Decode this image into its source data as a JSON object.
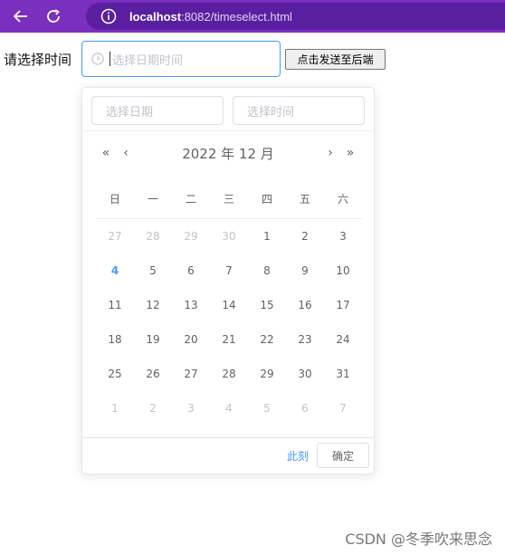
{
  "browser": {
    "url_host": "localhost",
    "url_rest": ":8082/timeselect.html",
    "toolbar_color": "#7b2fbf"
  },
  "form": {
    "label": "请选择时间",
    "input_placeholder": "选择日期时间",
    "send_button": "点击发送至后端"
  },
  "picker": {
    "date_placeholder": "选择日期",
    "time_placeholder": "选择时间",
    "year_month": "2022 年  12 月",
    "weekdays": [
      "日",
      "一",
      "二",
      "三",
      "四",
      "五",
      "六"
    ],
    "weeks": [
      [
        "27",
        "28",
        "29",
        "30",
        "1",
        "2",
        "3"
      ],
      [
        "4",
        "5",
        "6",
        "7",
        "8",
        "9",
        "10"
      ],
      [
        "11",
        "12",
        "13",
        "14",
        "15",
        "16",
        "17"
      ],
      [
        "18",
        "19",
        "20",
        "21",
        "22",
        "23",
        "24"
      ],
      [
        "25",
        "26",
        "27",
        "28",
        "29",
        "30",
        "31"
      ],
      [
        "1",
        "2",
        "3",
        "4",
        "5",
        "6",
        "7"
      ]
    ],
    "today": "4",
    "now_link": "此刻",
    "confirm_button": "确定",
    "accent_color": "#409eff"
  },
  "watermark": "CSDN @冬季吹来思念"
}
